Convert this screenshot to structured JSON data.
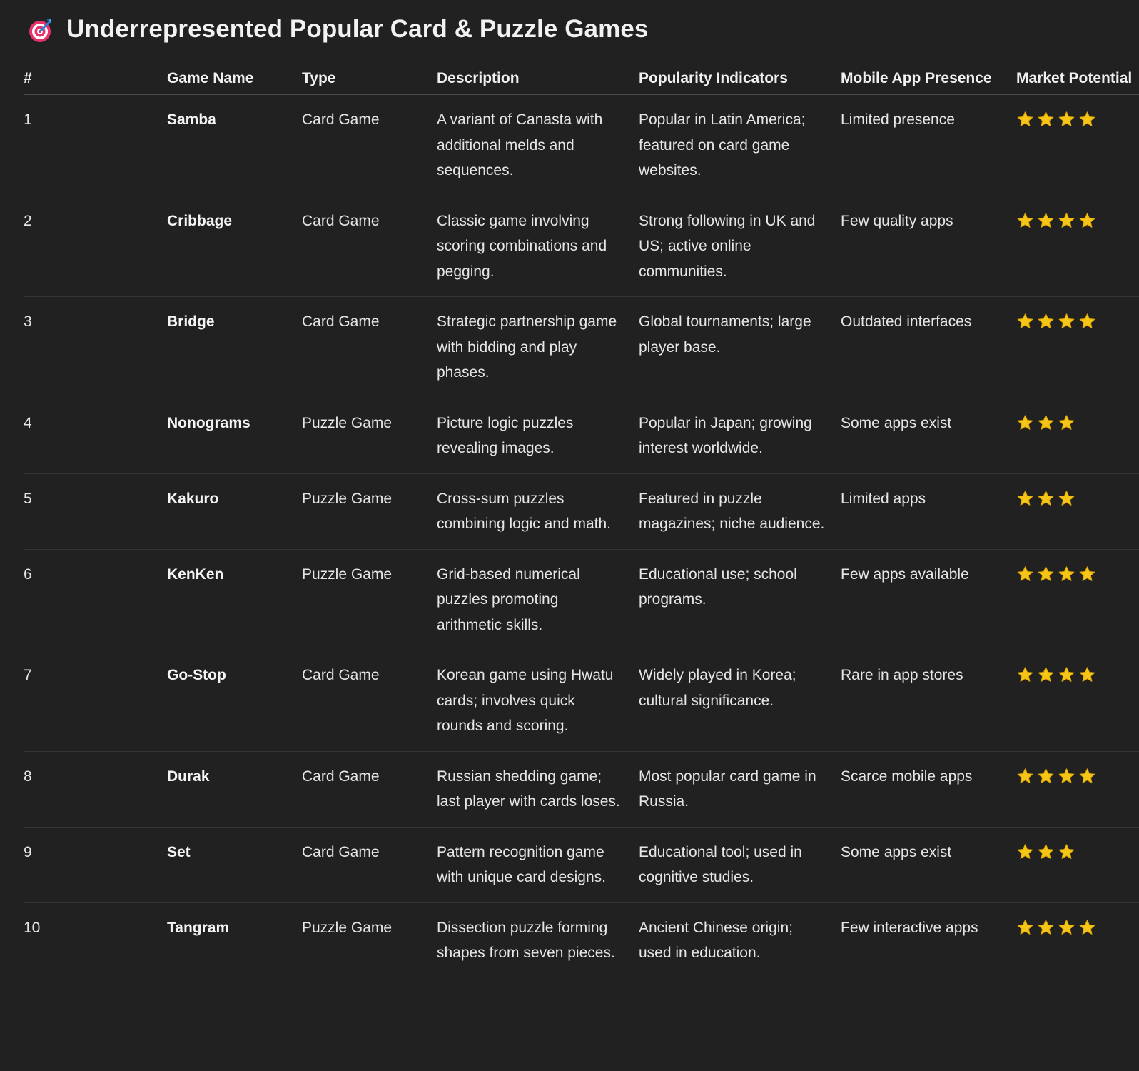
{
  "title": "Underrepresented Popular Card & Puzzle Games",
  "title_icon": "direct-hit-target-icon",
  "star_color": "#f5c518",
  "columns": [
    "#",
    "Game Name",
    "Type",
    "Description",
    "Popularity Indicators",
    "Mobile App Presence",
    "Market Potential"
  ],
  "rows": [
    {
      "num": "1",
      "name": "Samba",
      "type": "Card Game",
      "description": "A variant of Canasta with additional melds and sequences.",
      "popularity": "Popular in Latin America; featured on card game websites.",
      "mobile": "Limited presence",
      "stars": 4
    },
    {
      "num": "2",
      "name": "Cribbage",
      "type": "Card Game",
      "description": "Classic game involving scoring combinations and pegging.",
      "popularity": "Strong following in UK and US; active online communities.",
      "mobile": "Few quality apps",
      "stars": 4
    },
    {
      "num": "3",
      "name": "Bridge",
      "type": "Card Game",
      "description": "Strategic partnership game with bidding and play phases.",
      "popularity": "Global tournaments; large player base.",
      "mobile": "Outdated interfaces",
      "stars": 4
    },
    {
      "num": "4",
      "name": "Nonograms",
      "type": "Puzzle Game",
      "description": "Picture logic puzzles revealing images.",
      "popularity": "Popular in Japan; growing interest worldwide.",
      "mobile": "Some apps exist",
      "stars": 3
    },
    {
      "num": "5",
      "name": "Kakuro",
      "type": "Puzzle Game",
      "description": "Cross-sum puzzles combining logic and math.",
      "popularity": "Featured in puzzle magazines; niche audience.",
      "mobile": "Limited apps",
      "stars": 3
    },
    {
      "num": "6",
      "name": "KenKen",
      "type": "Puzzle Game",
      "description": "Grid-based numerical puzzles promoting arithmetic skills.",
      "popularity": "Educational use; school programs.",
      "mobile": "Few apps available",
      "stars": 4
    },
    {
      "num": "7",
      "name": "Go-Stop",
      "type": "Card Game",
      "description": "Korean game using Hwatu cards; involves quick rounds and scoring.",
      "popularity": "Widely played in Korea; cultural significance.",
      "mobile": "Rare in app stores",
      "stars": 4
    },
    {
      "num": "8",
      "name": "Durak",
      "type": "Card Game",
      "description": "Russian shedding game; last player with cards loses.",
      "popularity": "Most popular card game in Russia.",
      "mobile": "Scarce mobile apps",
      "stars": 4
    },
    {
      "num": "9",
      "name": "Set",
      "type": "Card Game",
      "description": "Pattern recognition game with unique card designs.",
      "popularity": "Educational tool; used in cognitive studies.",
      "mobile": "Some apps exist",
      "stars": 3
    },
    {
      "num": "10",
      "name": "Tangram",
      "type": "Puzzle Game",
      "description": "Dissection puzzle forming shapes from seven pieces.",
      "popularity": "Ancient Chinese origin; used in education.",
      "mobile": "Few interactive apps",
      "stars": 4
    }
  ]
}
